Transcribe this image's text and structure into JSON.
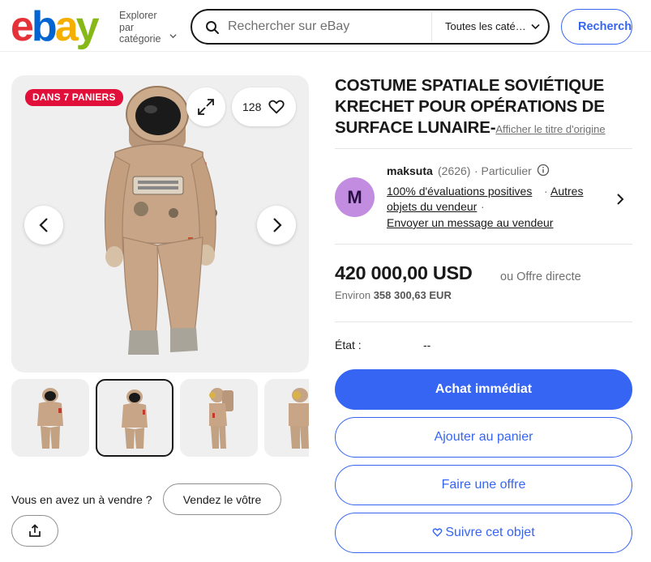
{
  "header": {
    "logo_letters": [
      "e",
      "b",
      "a",
      "y"
    ],
    "explore_label_1": "Explorer",
    "explore_label_2": "par",
    "explore_label_3": "catégorie",
    "search_placeholder": "Rechercher sur eBay",
    "category_selected": "Toutes les caté…",
    "search_button": "Recherch"
  },
  "gallery": {
    "badge": "DANS 7 PANIERS",
    "watch_count": "128",
    "thumbnail_count": 4,
    "selected_thumbnail": 2
  },
  "sell": {
    "question": "Vous en avez un à vendre ?",
    "button": "Vendez le vôtre"
  },
  "listing": {
    "title": "COSTUME SPATIALE SOVIÉTIQUE KRECHET POUR OPÉRATIONS DE SURFACE LUNAIRE-",
    "original_title_link": "Afficher le titre d'origine"
  },
  "seller": {
    "initial": "M",
    "name": "maksuta",
    "count": "(2626)",
    "type": "· Particulier",
    "feedback": "100% d'évaluations positives",
    "other_items_1": "Autres",
    "other_items_2": "objets du vendeur",
    "message": "Envoyer un message au vendeur"
  },
  "price": {
    "amount": "420 000,00 USD",
    "offer": "ou Offre directe",
    "approx_label": "Environ",
    "approx_value": "358 300,63 EUR"
  },
  "condition": {
    "label": "État :",
    "value": "--"
  },
  "actions": {
    "buy_now": "Achat immédiat",
    "add_to_cart": "Ajouter au panier",
    "make_offer": "Faire une offre",
    "watch": "Suivre cet objet"
  },
  "colors": {
    "accent": "#3665f3",
    "badge": "#e0103a",
    "avatar": "#c28de0",
    "suit": "#c8a587"
  }
}
